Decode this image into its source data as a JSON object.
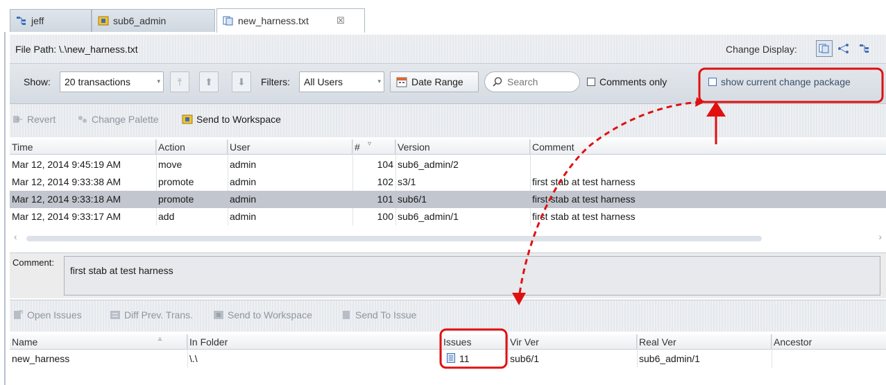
{
  "tabs": [
    {
      "label": "jeff",
      "icon": "stream-icon"
    },
    {
      "label": "sub6_admin",
      "icon": "workspace-icon"
    },
    {
      "label": "new_harness.txt",
      "icon": "file-history-icon",
      "close": "☒"
    }
  ],
  "header": {
    "file_path_label": "File Path: \\.\\new_harness.txt",
    "change_display_label": "Change Display:"
  },
  "toolbar": {
    "show_label": "Show:",
    "show_value": "20 transactions",
    "filters_label": "Filters:",
    "filters_value": "All Users",
    "date_range_label": "Date Range",
    "search_placeholder": "Search",
    "comments_only_label": "Comments only",
    "show_change_package_label": "show current change package"
  },
  "actions_top": {
    "revert": "Revert",
    "change_palette": "Change Palette",
    "send_to_workspace": "Send to Workspace"
  },
  "history_table": {
    "columns": [
      "Time",
      "Action",
      "User",
      "#",
      "Version",
      "Comment"
    ],
    "rows": [
      {
        "time": "Mar 12, 2014 9:45:19 AM",
        "action": "move",
        "user": "admin",
        "num": "104",
        "version": "sub6_admin/2",
        "comment": ""
      },
      {
        "time": "Mar 12, 2014 9:33:38 AM",
        "action": "promote",
        "user": "admin",
        "num": "102",
        "version": "s3/1",
        "comment": "first stab at test harness"
      },
      {
        "time": "Mar 12, 2014 9:33:18 AM",
        "action": "promote",
        "user": "admin",
        "num": "101",
        "version": "sub6/1",
        "comment": "first stab at test harness"
      },
      {
        "time": "Mar 12, 2014 9:33:17 AM",
        "action": "add",
        "user": "admin",
        "num": "100",
        "version": "sub6_admin/1",
        "comment": "first stab at test harness"
      }
    ],
    "selected_index": 2
  },
  "comment": {
    "label": "Comment:",
    "text": "first stab at test harness"
  },
  "actions_bottom": {
    "open_issues": "Open Issues",
    "diff_prev": "Diff Prev. Trans.",
    "send_to_workspace": "Send to Workspace",
    "send_to_issue": "Send To Issue"
  },
  "element_table": {
    "columns": [
      "Name",
      "In Folder",
      "Issues",
      "Vir Ver",
      "Real Ver",
      "Ancestor"
    ],
    "rows": [
      {
        "name": "new_harness",
        "folder": "\\.\\",
        "issues": "11",
        "vir_ver": "sub6/1",
        "real_ver": "sub6_admin/1",
        "ancestor": ""
      }
    ]
  },
  "colors": {
    "highlight": "#e01010",
    "selected_row": "#c1c6cf",
    "checkbox_blue": "#3d6fb6"
  }
}
